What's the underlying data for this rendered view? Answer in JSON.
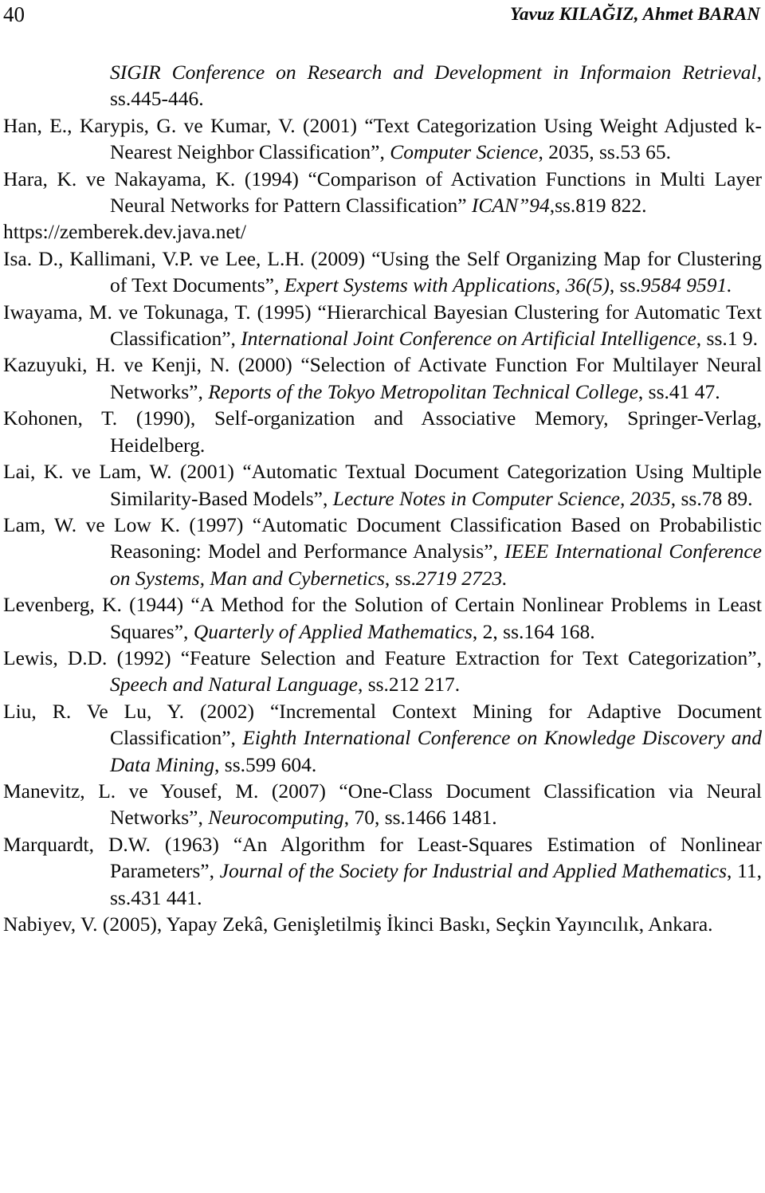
{
  "page": {
    "folio": "40",
    "running_header": "Yavuz KILAĞIZ, Ahmet BARAN"
  },
  "references": [
    {
      "id": "ref-sigir-continuation",
      "continuation": true,
      "runs": [
        {
          "style": "italic",
          "text": "SIGIR Conference on Research and Development in Informaion Retrieval"
        },
        {
          "style": "roman",
          "text": ", ss.445-446."
        }
      ],
      "plain_text": "SIGIR Conference on Research and Development in Informaion Retrieval, ss.445-446."
    },
    {
      "id": "ref-han-2001",
      "continuation": false,
      "runs": [
        {
          "style": "roman",
          "text": "Han, E.,  Karypis, G. ve Kumar, V. (2001) “Text Categorization Using Weight Adjusted k-Nearest Neighbor Classification”, "
        },
        {
          "style": "italic",
          "text": "Computer Science"
        },
        {
          "style": "roman",
          "text": ", 2035, ss.53 65."
        }
      ],
      "plain_text": "Han, E.,  Karypis, G. ve Kumar, V. (2001) “Text Categorization Using Weight Adjusted k-Nearest Neighbor Classification”, Computer Science, 2035, ss.53 65."
    },
    {
      "id": "ref-hara-1994",
      "continuation": false,
      "runs": [
        {
          "style": "roman",
          "text": "Hara, K. ve Nakayama, K. (1994) “Comparison of Activation Functions in Multi Layer Neural Networks for Pattern Classification” "
        },
        {
          "style": "italic",
          "text": "ICAN”94"
        },
        {
          "style": "roman",
          "text": ",ss.819 822."
        }
      ],
      "plain_text": "Hara, K. ve Nakayama, K. (1994) “Comparison of Activation Functions in Multi Layer Neural Networks for Pattern Classification” ICAN”94,ss.819 822."
    },
    {
      "id": "ref-zemberek-url",
      "continuation": false,
      "plain": true,
      "runs": [
        {
          "style": "roman",
          "text": "https://zemberek.dev.java.net/"
        }
      ],
      "plain_text": "https://zemberek.dev.java.net/"
    },
    {
      "id": "ref-isa-2009",
      "continuation": false,
      "runs": [
        {
          "style": "roman",
          "text": "Isa. D., Kallimani, V.P. ve Lee, L.H. (2009) “Using the Self Organizing Map for Clustering of Text Documents”, "
        },
        {
          "style": "italic",
          "text": "Expert Systems with Applications, 36(5)"
        },
        {
          "style": "roman",
          "text": ", ss."
        },
        {
          "style": "italic",
          "text": "9584 9591."
        }
      ],
      "plain_text": "Isa. D., Kallimani, V.P. ve Lee, L.H. (2009) “Using the Self Organizing Map for Clustering of Text Documents”, Expert Systems with Applications, 36(5), ss.9584 9591."
    },
    {
      "id": "ref-iwayama-1995",
      "continuation": false,
      "runs": [
        {
          "style": "roman",
          "text": "Iwayama, M. ve Tokunaga, T. (1995) “Hierarchical Bayesian Clustering for Automatic Text Classification”, "
        },
        {
          "style": "italic",
          "text": "International Joint Conference on Artificial Intelligence"
        },
        {
          "style": "roman",
          "text": ", ss.1 9."
        }
      ],
      "plain_text": "Iwayama, M. ve Tokunaga, T. (1995) “Hierarchical Bayesian Clustering for Automatic Text Classification”, International Joint Conference on Artificial Intelligence, ss.1 9."
    },
    {
      "id": "ref-kazuyuki-2000",
      "continuation": false,
      "runs": [
        {
          "style": "roman",
          "text": "Kazuyuki, H. ve Kenji, N. (2000) “Selection of Activate Function For Multilayer Neural Networks”, "
        },
        {
          "style": "italic",
          "text": "Reports of the Tokyo Metropolitan Technical College"
        },
        {
          "style": "roman",
          "text": ", ss.41 47."
        }
      ],
      "plain_text": "Kazuyuki, H. ve Kenji, N. (2000) “Selection of Activate Function For Multilayer Neural Networks”, Reports of the Tokyo Metropolitan Technical College, ss.41 47."
    },
    {
      "id": "ref-kohonen-1990",
      "continuation": false,
      "runs": [
        {
          "style": "roman",
          "text": "Kohonen, T. (1990), Self-organization and Associative Memory, Springer-Verlag, Heidelberg."
        }
      ],
      "plain_text": "Kohonen, T. (1990), Self-organization and Associative Memory, Springer-Verlag, Heidelberg."
    },
    {
      "id": "ref-lai-2001",
      "continuation": false,
      "runs": [
        {
          "style": "roman",
          "text": "Lai, K. ve Lam, W. (2001) “Automatic Textual Document Categorization Using Multiple Similarity-Based Models”, "
        },
        {
          "style": "italic",
          "text": "Lecture Notes in Computer Science, 2035"
        },
        {
          "style": "roman",
          "text": ", ss.78 89."
        }
      ],
      "plain_text": "Lai, K. ve Lam, W. (2001) “Automatic Textual Document Categorization Using Multiple Similarity-Based Models”, Lecture Notes in Computer Science, 2035, ss.78 89."
    },
    {
      "id": "ref-lam-1997",
      "continuation": false,
      "runs": [
        {
          "style": "roman",
          "text": "Lam, W. ve Low K. (1997) “Automatic Document Classification Based on Probabilistic Reasoning: Model and Performance Analysis”, "
        },
        {
          "style": "italic",
          "text": "IEEE International Conference on Systems, Man and Cybernetics"
        },
        {
          "style": "roman",
          "text": ", ss."
        },
        {
          "style": "italic",
          "text": "2719 2723."
        }
      ],
      "plain_text": "Lam, W. ve Low K. (1997) “Automatic Document Classification Based on Probabilistic Reasoning: Model and Performance Analysis”, IEEE International Conference on Systems, Man and Cybernetics, ss.2719 2723."
    },
    {
      "id": "ref-levenberg-1944",
      "continuation": false,
      "runs": [
        {
          "style": "roman",
          "text": "Levenberg, K. (1944) “A Method for the Solution of Certain Nonlinear Problems in Least Squares”,  "
        },
        {
          "style": "italic",
          "text": "Quarterly of Applied Mathematics"
        },
        {
          "style": "roman",
          "text": ", 2, ss.164 168."
        }
      ],
      "plain_text": "Levenberg, K. (1944) “A Method for the Solution of Certain Nonlinear Problems in Least Squares”, Quarterly of Applied Mathematics, 2, ss.164 168."
    },
    {
      "id": "ref-lewis-1992",
      "continuation": false,
      "runs": [
        {
          "style": "roman",
          "text": "Lewis, D.D. (1992) “Feature Selection and Feature Extraction for Text Categorization”, "
        },
        {
          "style": "italic",
          "text": "Speech and Natural Language"
        },
        {
          "style": "roman",
          "text": ",  ss.212 217."
        }
      ],
      "plain_text": "Lewis, D.D. (1992) “Feature Selection and Feature Extraction for Text Categorization”, Speech and Natural Language,  ss.212 217."
    },
    {
      "id": "ref-liu-2002",
      "continuation": false,
      "runs": [
        {
          "style": "roman",
          "text": "Liu, R. Ve Lu, Y. (2002) “Incremental Context Mining for Adaptive Document Classification”, "
        },
        {
          "style": "italic",
          "text": "Eighth International Conference on Knowledge Discovery and Data Mining"
        },
        {
          "style": "roman",
          "text": ", ss.599 604."
        }
      ],
      "plain_text": "Liu, R. Ve Lu, Y. (2002) “Incremental Context Mining for Adaptive Document Classification”, Eighth International Conference on Knowledge Discovery and Data Mining, ss.599 604."
    },
    {
      "id": "ref-manevitz-2007",
      "continuation": false,
      "runs": [
        {
          "style": "roman",
          "text": "Manevitz, L. ve Yousef, M. (2007) “One-Class Document Classification via Neural Networks”, "
        },
        {
          "style": "italic",
          "text": "Neurocomputing"
        },
        {
          "style": "roman",
          "text": ", 70, ss.1466 1481."
        }
      ],
      "plain_text": "Manevitz, L. ve Yousef, M. (2007) “One-Class Document Classification via Neural Networks”, Neurocomputing, 70, ss.1466 1481."
    },
    {
      "id": "ref-marquardt-1963",
      "continuation": false,
      "runs": [
        {
          "style": "roman",
          "text": "Marquardt, D.W. (1963) “An Algorithm for Least-Squares Estimation of Nonlinear Parameters”, "
        },
        {
          "style": "italic",
          "text": "Journal of the Society for Industrial and Applied Mathematics"
        },
        {
          "style": "roman",
          "text": ", 11, ss.431 441."
        }
      ],
      "plain_text": "Marquardt, D.W. (1963) “An Algorithm for Least-Squares Estimation of Nonlinear Parameters”, Journal of the Society for Industrial and Applied Mathematics, 11, ss.431 441."
    },
    {
      "id": "ref-nabiyev-2005",
      "continuation": false,
      "runs": [
        {
          "style": "roman",
          "text": "Nabiyev, V. (2005), Yapay Zekâ, Genişletilmiş İkinci Baskı, Seçkin Yayıncılık, Ankara."
        }
      ],
      "plain_text": "Nabiyev, V. (2005), Yapay Zekâ, Genişletilmiş İkinci Baskı, Seçkin Yayıncılık, Ankara."
    }
  ]
}
